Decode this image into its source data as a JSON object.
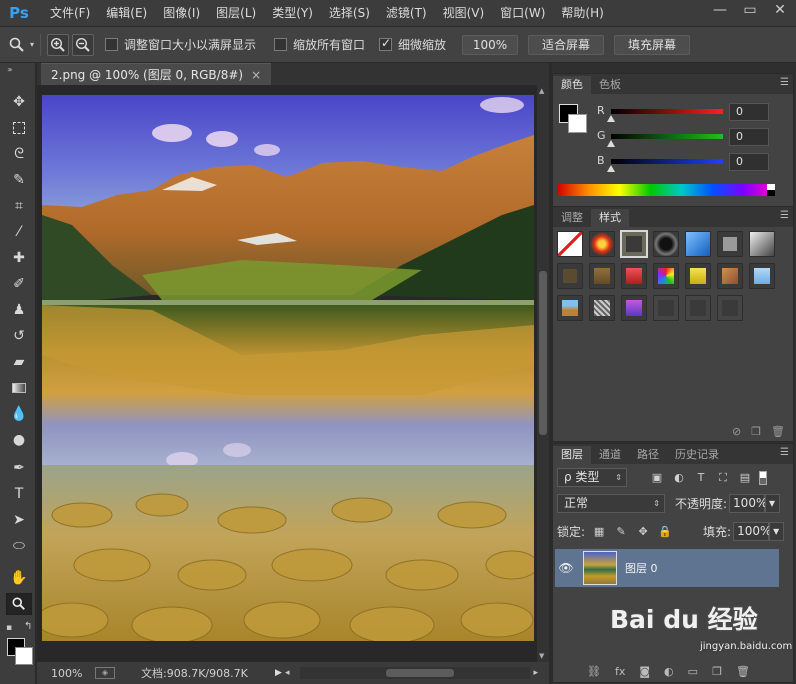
{
  "app": {
    "logo": "Ps"
  },
  "menu": [
    "文件(F)",
    "编辑(E)",
    "图像(I)",
    "图层(L)",
    "类型(Y)",
    "选择(S)",
    "滤镜(T)",
    "视图(V)",
    "窗口(W)",
    "帮助(H)"
  ],
  "window_controls": {
    "minimize": "—",
    "restore": "▭",
    "close": "✕"
  },
  "options_bar": {
    "checkbox_resize": {
      "label": "调整窗口大小以满屏显示",
      "checked": false
    },
    "checkbox_zoom_all": {
      "label": "缩放所有窗口",
      "checked": false
    },
    "checkbox_scrubby": {
      "label": "细微缩放",
      "checked": true
    },
    "btn_100": "100%",
    "btn_fit": "适合屏幕",
    "btn_fill": "填充屏幕"
  },
  "document": {
    "tab_title": "2.png @ 100% (图层 0, RGB/8#)",
    "tab_close": "×",
    "zoom_status": "100%",
    "doc_status": "文档:908.7K/908.7K"
  },
  "tools": [
    "move-icon",
    "marquee-icon",
    "lasso-icon",
    "quick-select-icon",
    "crop-icon",
    "eyedropper-icon",
    "healing-icon",
    "brush-icon",
    "stamp-icon",
    "history-brush-icon",
    "eraser-icon",
    "gradient-icon",
    "blur-icon",
    "dodge-icon",
    "pen-icon",
    "type-icon",
    "path-select-icon",
    "shape-icon",
    "hand-icon",
    "zoom-icon"
  ],
  "color_panel": {
    "tabs": [
      "颜色",
      "色板"
    ],
    "channels": [
      {
        "label": "R",
        "value": "0",
        "color": "#ff2020"
      },
      {
        "label": "G",
        "value": "0",
        "color": "#20c020"
      },
      {
        "label": "B",
        "value": "0",
        "color": "#2040ff"
      }
    ]
  },
  "styles_panel": {
    "tabs": [
      "调整",
      "样式"
    ]
  },
  "layers_panel": {
    "tabs": [
      "图层",
      "通道",
      "路径",
      "历史记录"
    ],
    "filter_label": "ρ 类型",
    "blend_mode": "正常",
    "opacity_label": "不透明度:",
    "opacity_value": "100%",
    "lock_label": "锁定:",
    "fill_label": "填充:",
    "fill_value": "100%",
    "layer_name": "图层 0"
  },
  "watermark": {
    "brand": "Bai du 经验",
    "url": "jingyan.baidu.com"
  }
}
